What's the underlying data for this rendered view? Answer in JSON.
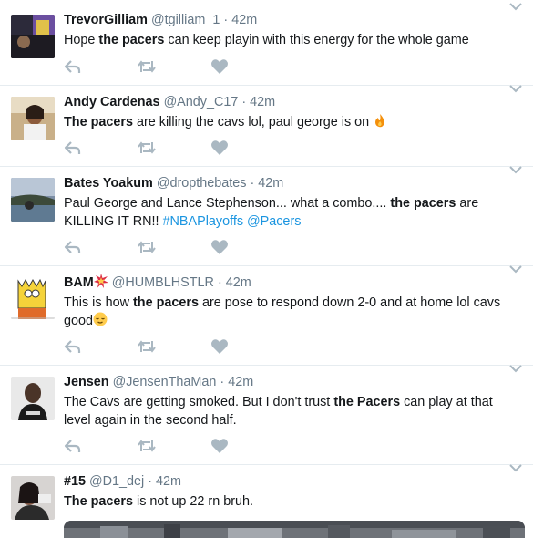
{
  "tweets": [
    {
      "name": "TrevorGilliam",
      "handle": "@tgilliam_1",
      "time": "42m",
      "text_parts": [
        "Hope ",
        "the pacers",
        " can keep playin with this energy for the whole game"
      ]
    },
    {
      "name": "Andy Cardenas",
      "handle": "@Andy_C17",
      "time": "42m",
      "text_parts": [
        "The pacers",
        " are killing the cavs lol, paul george is on"
      ],
      "emoji": "fire-emoji"
    },
    {
      "name": "Bates Yoakum",
      "handle": "@dropthebates",
      "time": "42m",
      "text_parts": [
        "Paul George and Lance Stephenson... what a combo.... ",
        "the pacers",
        " are KILLING IT RN!! "
      ],
      "hashtag": "#NBAPlayoffs",
      "mention": "@Pacers"
    },
    {
      "name": "BAM",
      "name_emoji": "collision-emoji",
      "handle": "@HUMBLHSTLR",
      "time": "42m",
      "text_parts": [
        "This is how ",
        "the pacers",
        " are pose to respond down 2-0 and at home lol cavs good"
      ],
      "emoji": "relieved-face-emoji"
    },
    {
      "name": "Jensen",
      "handle": "@JensenThaMan",
      "time": "42m",
      "text_parts": [
        "The Cavs are getting smoked. But I don't trust ",
        "the Pacers",
        " can play at that level again in the second half."
      ]
    },
    {
      "name": "#15",
      "handle": "@D1_dej",
      "time": "42m",
      "text_parts": [
        "The pacers",
        " is not up 22 rn bruh."
      ]
    }
  ],
  "icons": {
    "reply": "reply-icon",
    "retweet": "retweet-icon",
    "like": "heart-icon",
    "caret": "chevron-down-icon"
  },
  "colors": {
    "text": "#14171a",
    "secondary": "#657786",
    "link": "#1b95e0",
    "icon": "#aab8c2",
    "divider": "#e6ecf0"
  }
}
